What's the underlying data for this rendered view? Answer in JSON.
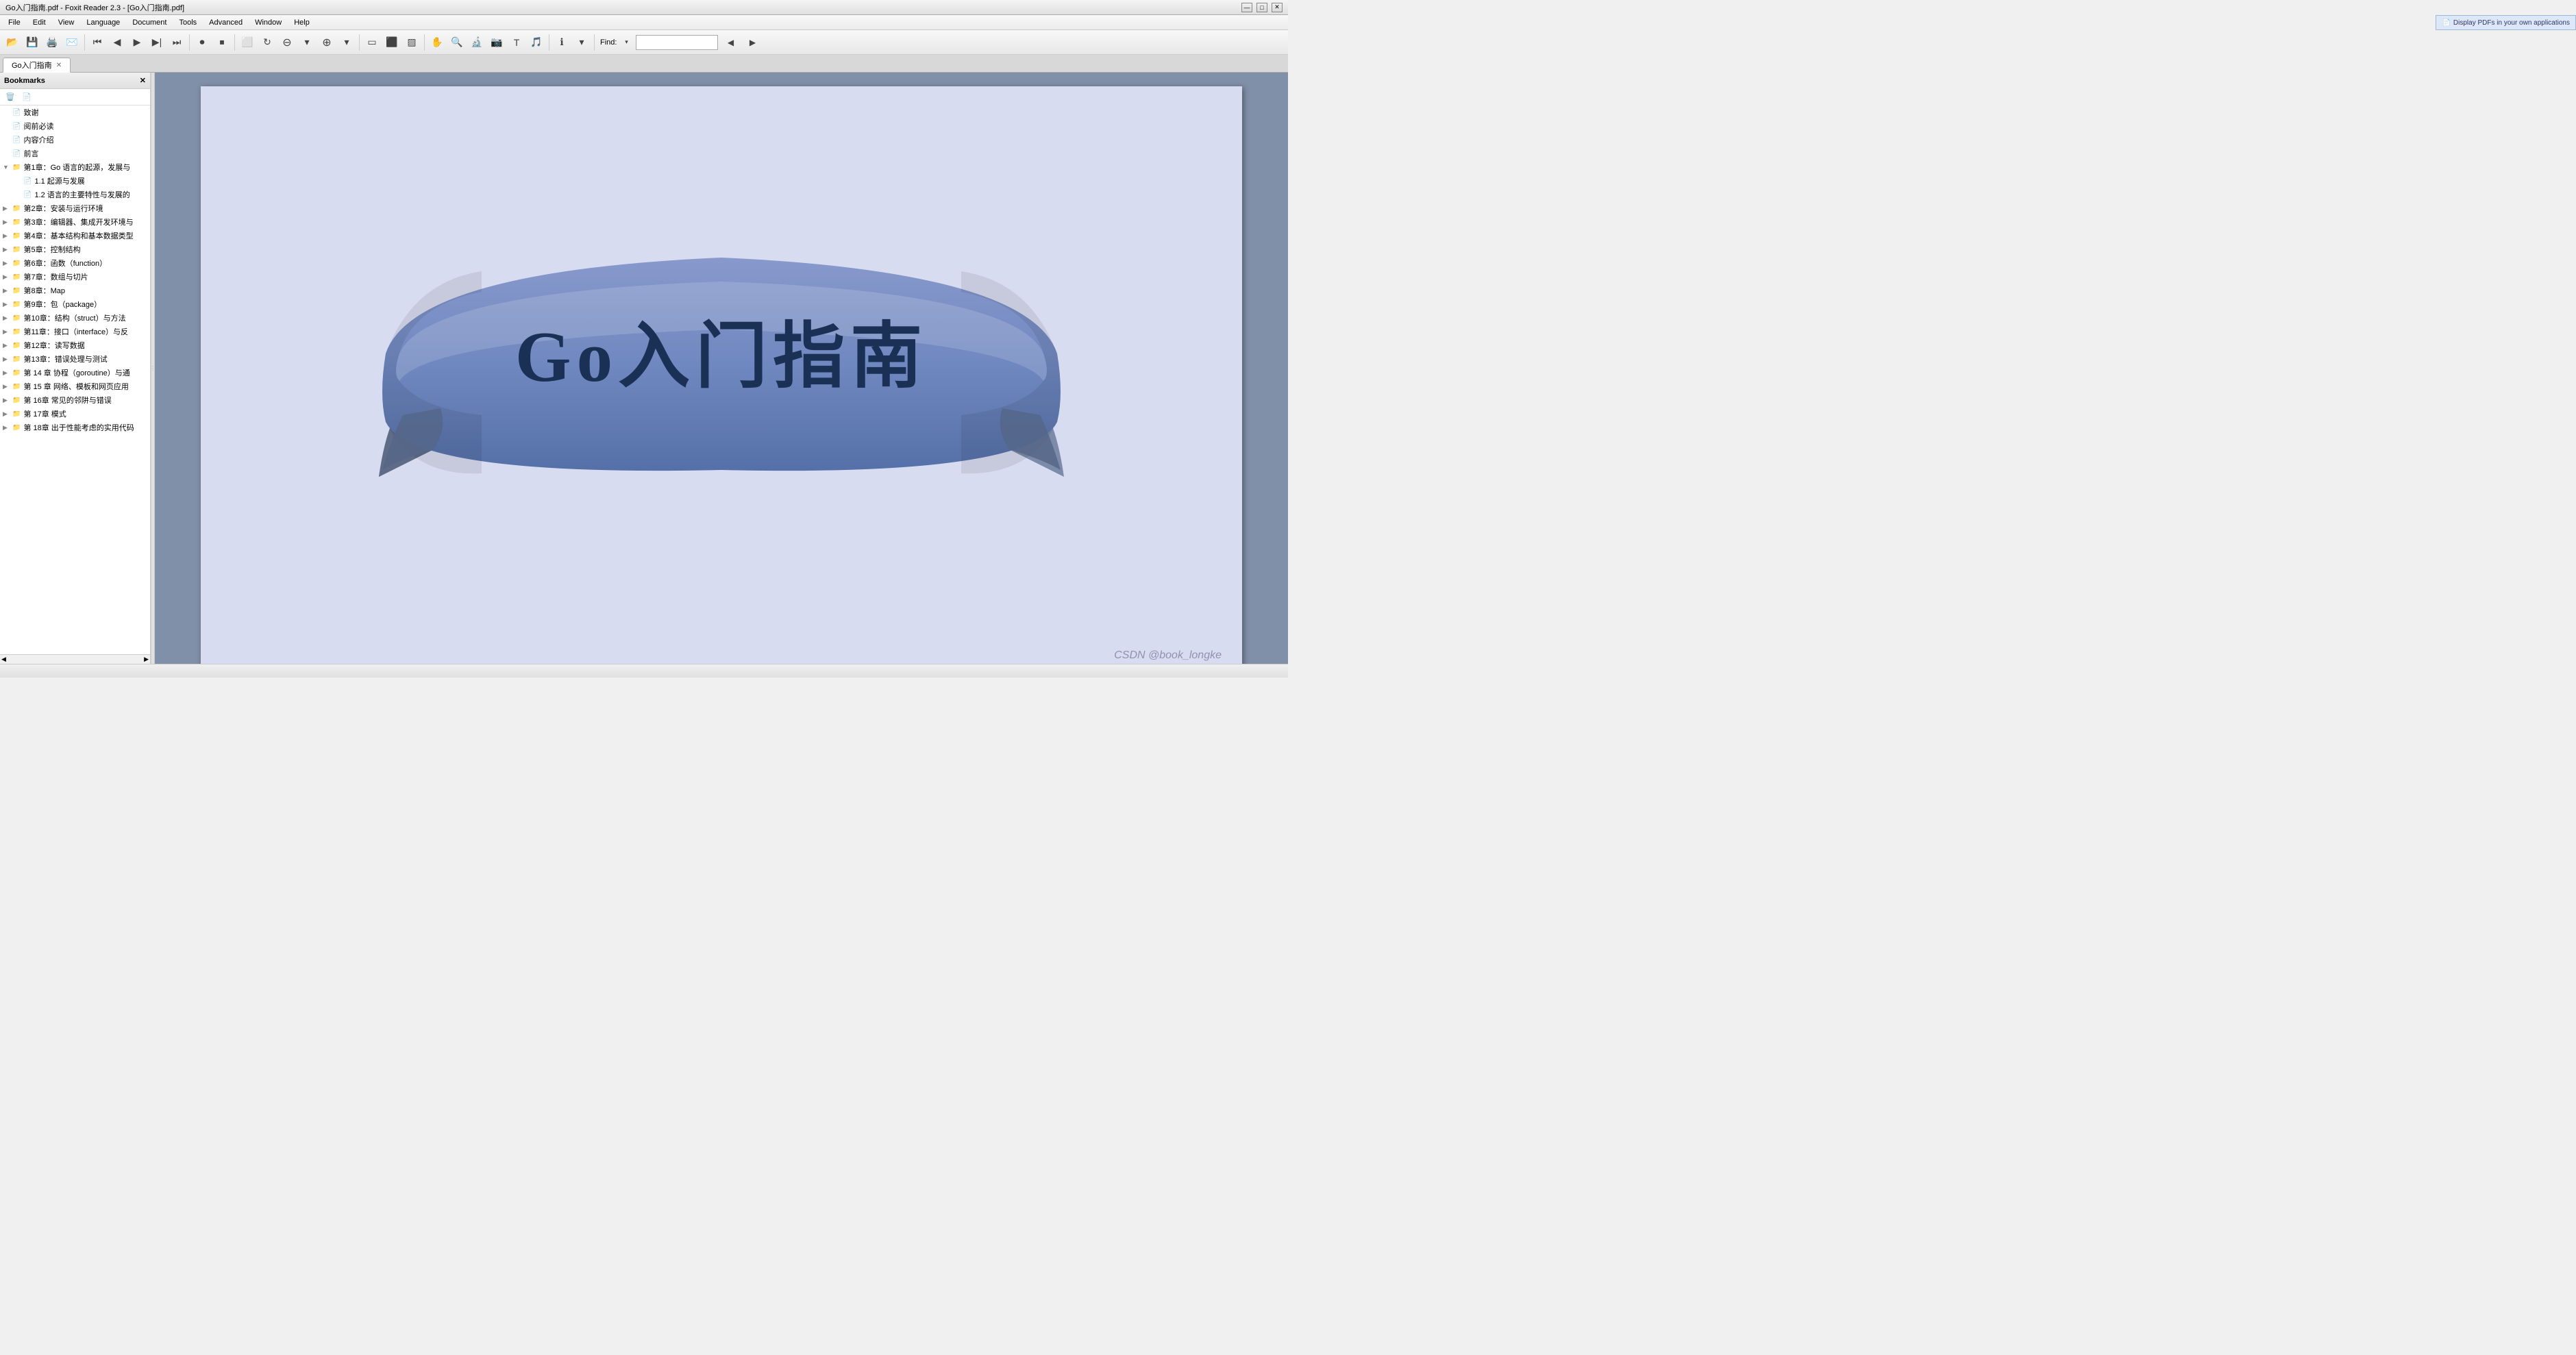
{
  "titlebar": {
    "text": "Go入门指南.pdf - Foxit Reader 2.3 - [Go入门指南.pdf]",
    "min_label": "—",
    "max_label": "□",
    "close_label": "✕"
  },
  "menubar": {
    "items": [
      "File",
      "Edit",
      "View",
      "Language",
      "Document",
      "Tools",
      "Advanced",
      "Window",
      "Help"
    ]
  },
  "ad_banner": {
    "text": "Display PDFs in your own applications"
  },
  "toolbar": {
    "find_label": "Find:",
    "find_placeholder": ""
  },
  "tabs": [
    {
      "label": "Go入门指南",
      "active": true
    }
  ],
  "sidebar": {
    "title": "Bookmarks",
    "bookmarks": [
      {
        "level": 0,
        "label": "致谢",
        "expandable": false
      },
      {
        "level": 0,
        "label": "阅前必读",
        "expandable": false
      },
      {
        "level": 0,
        "label": "内容介绍",
        "expandable": false
      },
      {
        "level": 0,
        "label": "前言",
        "expandable": false
      },
      {
        "level": 0,
        "label": "第1章：Go 语言的起源，发展与",
        "expandable": true,
        "expanded": true
      },
      {
        "level": 1,
        "label": "1.1 起源与发展",
        "expandable": false
      },
      {
        "level": 1,
        "label": "1.2 语言的主要特性与发展的",
        "expandable": false
      },
      {
        "level": 0,
        "label": "第2章：安装与运行环境",
        "expandable": true
      },
      {
        "level": 0,
        "label": "第3章：编辑器、集成开发环境与",
        "expandable": true
      },
      {
        "level": 0,
        "label": "第4章：基本结构和基本数据类型",
        "expandable": true
      },
      {
        "level": 0,
        "label": "第5章：控制结构",
        "expandable": true
      },
      {
        "level": 0,
        "label": "第6章：函数（function）",
        "expandable": true
      },
      {
        "level": 0,
        "label": "第7章：数组与切片",
        "expandable": true
      },
      {
        "level": 0,
        "label": "第8章：Map",
        "expandable": true
      },
      {
        "level": 0,
        "label": "第9章：包（package）",
        "expandable": true
      },
      {
        "level": 0,
        "label": "第10章：结构（struct）与方法",
        "expandable": true
      },
      {
        "level": 0,
        "label": "第11章：接口（interface）与反",
        "expandable": true
      },
      {
        "level": 0,
        "label": "第12章：读写数据",
        "expandable": true
      },
      {
        "level": 0,
        "label": "第13章：错误处理与测试",
        "expandable": true
      },
      {
        "level": 0,
        "label": "第 14 章 协程（goroutine）与通",
        "expandable": true
      },
      {
        "level": 0,
        "label": "第 15 章 网络、模板和网页应用",
        "expandable": true
      },
      {
        "level": 0,
        "label": "第 16章 常见的邻阱与错误",
        "expandable": true
      },
      {
        "level": 0,
        "label": "第 17章 模式",
        "expandable": true
      },
      {
        "level": 0,
        "label": "第 18章 出于性能考虑的实用代码",
        "expandable": true
      }
    ]
  },
  "pdf": {
    "title": "Go入门指南",
    "watermark": "CSDN @book_longke"
  },
  "statusbar": {
    "text": ""
  }
}
